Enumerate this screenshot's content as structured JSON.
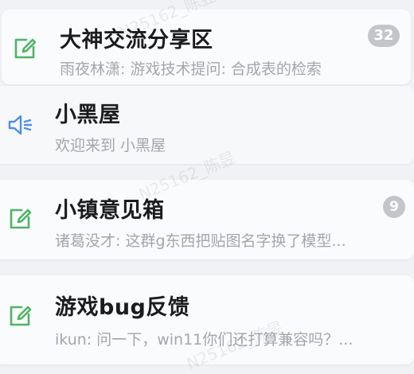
{
  "watermark": "N25162_陈昱",
  "channels": [
    {
      "title": "大神交流分享区",
      "subtitle": "雨夜林潇: 游戏技术提问: 合成表的检索",
      "icon": "edit-icon",
      "badge": "32"
    },
    {
      "title": "小黑屋",
      "subtitle": "欢迎来到 小黑屋",
      "icon": "speaker-icon",
      "badge": ""
    },
    {
      "title": "小镇意见箱",
      "subtitle": "诸葛没才: 这群g东西把贴图名字换了模型...",
      "icon": "edit-icon",
      "badge": "9"
    },
    {
      "title": "游戏bug反馈",
      "subtitle": "ikun: 问一下，win11你们还打算兼容吗？...",
      "icon": "edit-icon",
      "badge": ""
    }
  ],
  "colors": {
    "edit_icon": "#4cb564",
    "speaker_icon": "#4f8fe6",
    "badge": "#c3c5ca"
  }
}
